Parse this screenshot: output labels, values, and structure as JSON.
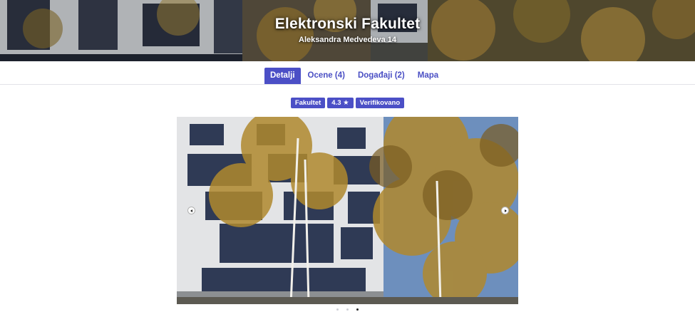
{
  "hero": {
    "title": "Elektronski Fakultet",
    "address": "Aleksandra Medvedeva 14"
  },
  "tabs": [
    {
      "label": "Detalji",
      "active": true
    },
    {
      "label": "Ocene (4)",
      "active": false
    },
    {
      "label": "Događaji (2)",
      "active": false
    },
    {
      "label": "Mapa",
      "active": false
    }
  ],
  "badges": [
    {
      "label": "Fakultet"
    },
    {
      "label": "4.3 ★"
    },
    {
      "label": "Verifikovano"
    }
  ],
  "carousel": {
    "prev_icon": "chevron-left-icon",
    "next_icon": "chevron-right-icon",
    "slide_count": 3,
    "active_slide": 3
  },
  "colors": {
    "accent": "#4b4fc6",
    "tab_text": "#4a4fc4"
  }
}
